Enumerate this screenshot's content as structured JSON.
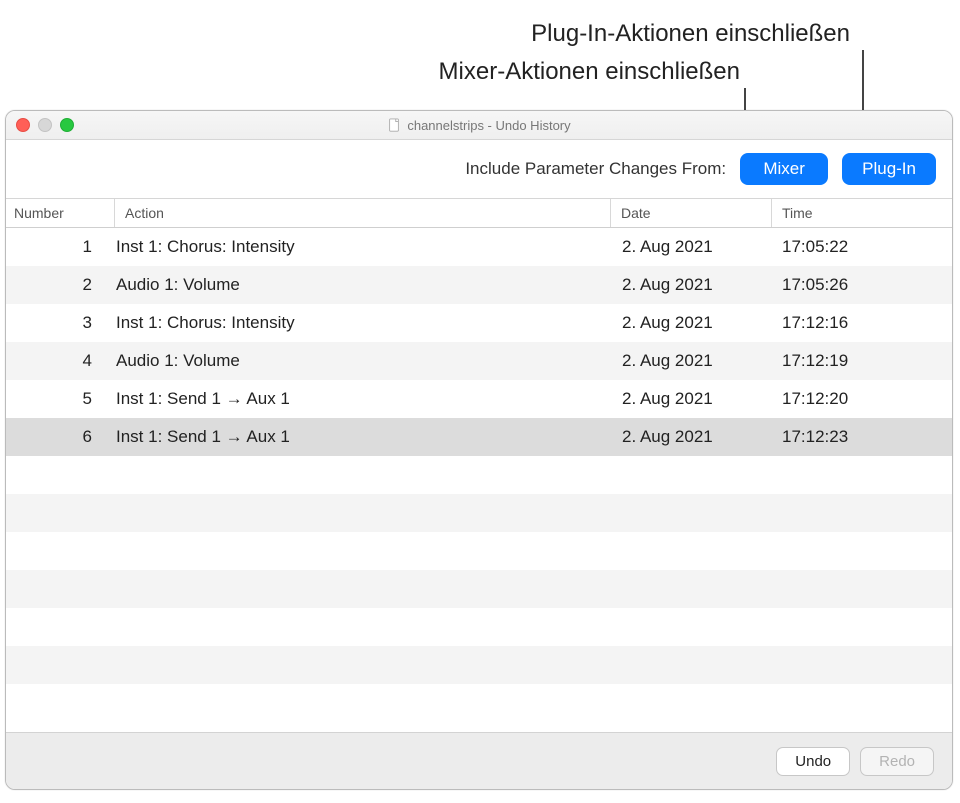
{
  "callouts": {
    "plugin": "Plug-In-Aktionen einschließen",
    "mixer": "Mixer-Aktionen einschließen"
  },
  "window": {
    "title": "channelstrips - Undo History"
  },
  "toolbar": {
    "label": "Include Parameter Changes From:",
    "mixer_button": "Mixer",
    "plugin_button": "Plug-In"
  },
  "columns": {
    "number": "Number",
    "action": "Action",
    "date": "Date",
    "time": "Time"
  },
  "rows": [
    {
      "n": "1",
      "action": "Inst 1: Chorus: Intensity",
      "date": "2. Aug 2021",
      "time": "17:05:22"
    },
    {
      "n": "2",
      "action": "Audio 1: Volume",
      "date": "2. Aug 2021",
      "time": "17:05:26"
    },
    {
      "n": "3",
      "action": "Inst 1: Chorus: Intensity",
      "date": "2. Aug 2021",
      "time": "17:12:16"
    },
    {
      "n": "4",
      "action": "Audio 1: Volume",
      "date": "2. Aug 2021",
      "time": "17:12:19"
    },
    {
      "n": "5",
      "action": "Inst 1: Send 1 → Aux 1",
      "date": "2. Aug 2021",
      "time": "17:12:20"
    },
    {
      "n": "6",
      "action": "Inst 1: Send 1 → Aux 1",
      "date": "2. Aug 2021",
      "time": "17:12:23"
    }
  ],
  "selected_index": 5,
  "footer": {
    "undo": "Undo",
    "redo": "Redo",
    "redo_enabled": false
  }
}
